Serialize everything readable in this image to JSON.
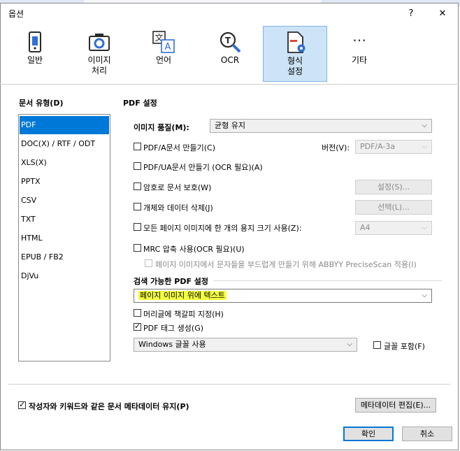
{
  "window": {
    "title": "옵션",
    "help": "?",
    "close": "✕"
  },
  "tabs": [
    {
      "label": "일반",
      "icon": "phone-icon"
    },
    {
      "label": "이미지\n처리",
      "icon": "camera-icon"
    },
    {
      "label": "언어",
      "icon": "translate-icon"
    },
    {
      "label": "OCR",
      "icon": "ocr-magnifier-icon"
    },
    {
      "label": "형식\n설정",
      "icon": "document-gear-icon",
      "active": true
    },
    {
      "label": "기타",
      "icon": "more-icon"
    }
  ],
  "doc_types": {
    "heading": "문서 유형(D)",
    "items": [
      "PDF",
      "DOC(X) / RTF / ODT",
      "XLS(X)",
      "PPTX",
      "CSV",
      "TXT",
      "HTML",
      "EPUB / FB2",
      "DjVu"
    ],
    "selected": "PDF"
  },
  "pdf": {
    "heading": "PDF 설정",
    "image_quality_label": "이미지 품질(M):",
    "image_quality_value": "균형 유지",
    "pdfa_label": "PDF/A문서 만들기(C)",
    "version_label": "버전(V):",
    "version_value": "PDF/A-3a",
    "pdfua_label": "PDF/UA문서 만들기 (OCR 필요)(A)",
    "password_label": "암호로 문서 보호(W)",
    "settings_button": "설정(S)...",
    "delete_label": "개체와 데이터 삭제(J)",
    "select_button": "선택(L)...",
    "paper_label": "모든 페이지 이미지에 한 개의 용지 크기 사용(Z):",
    "paper_value": "A4",
    "mrc_label": "MRC 압축 사용(OCR 필요)(U)",
    "precisescan_label": "페이지 이미지에서 문자들을 부드럽게 만들기 위해 ABBYY PreciseScan 적용(I)"
  },
  "searchable": {
    "heading": "검색 가능한 PDF 설정",
    "mode_value": "페이지 이미지 위에 텍스트",
    "bookmark_label": "머리글에 책갈피 지정(H)",
    "tags_label": "PDF 태그 생성(G)",
    "font_value": "Windows 글꼴 사용",
    "embed_label": "글꼴 포함(F)"
  },
  "footer": {
    "metadata_label": "작성자와 키워드와 같은 문서 메타데이터 유지(P)",
    "edit_metadata_button": "메타데이터 편집(E)...",
    "ok_button": "확인",
    "cancel_button": "취소"
  },
  "colors": {
    "accent": "#0078d7",
    "tab_active_bg": "#cde3f7",
    "highlight": "#f5ff3b"
  }
}
